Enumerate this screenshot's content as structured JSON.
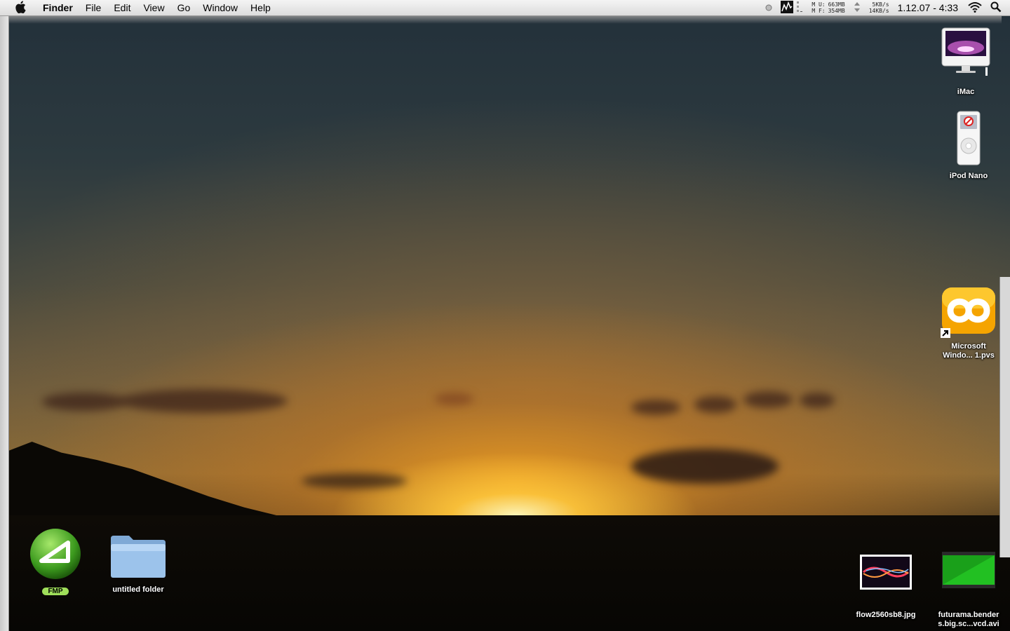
{
  "menubar": {
    "app_name": "Finder",
    "menus": [
      "File",
      "Edit",
      "View",
      "Go",
      "Window",
      "Help"
    ],
    "memory": {
      "used_label": "U:",
      "free_label": "F:",
      "used": "663MB",
      "free": "354MB"
    },
    "network": {
      "up": "5KB/s",
      "down": "14KB/s"
    },
    "clock": "1.12.07 - 4:33"
  },
  "desktop": {
    "icons": [
      {
        "label": "iMac",
        "icon": "imac-icon"
      },
      {
        "label": "iPod Nano",
        "icon": "ipod-nano-icon"
      },
      {
        "label_line1": "Microsoft",
        "label_line2": "Windo... 1.pvs",
        "icon": "parallels-icon"
      },
      {
        "label": "FMP",
        "icon": "fmp-app-icon"
      },
      {
        "label": "untitled folder",
        "icon": "folder-icon"
      },
      {
        "label": "flow2560sb8.jpg",
        "icon": "image-file-icon"
      },
      {
        "label_line1": "futurama.bender",
        "label_line2": "s.big.sc...vcd.avi",
        "icon": "video-file-icon"
      }
    ]
  },
  "colors": {
    "menubar": "#e6e6e6",
    "label_badge_green": "#9fdf5a",
    "parallels_orange": "#f5a400"
  }
}
